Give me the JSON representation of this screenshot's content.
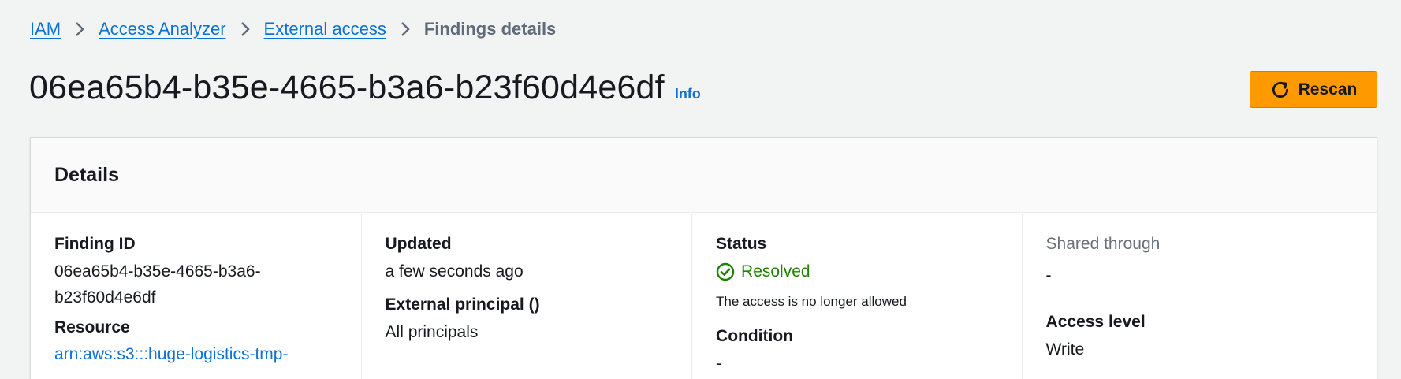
{
  "breadcrumb": {
    "items": [
      "IAM",
      "Access Analyzer",
      "External access"
    ],
    "current": "Findings details"
  },
  "header": {
    "title": "06ea65b4-b35e-4665-b3a6-b23f60d4e6df",
    "info": "Info",
    "rescan_label": "Rescan"
  },
  "details": {
    "title": "Details",
    "finding_id": {
      "label": "Finding ID",
      "value_line1": "06ea65b4-b35e-4665-b3a6-",
      "value_line2": "b23f60d4e6df"
    },
    "resource": {
      "label": "Resource",
      "value": "arn:aws:s3:::huge-logistics-tmp-"
    },
    "updated": {
      "label": "Updated",
      "value": "a few seconds ago"
    },
    "external_principal": {
      "label": "External principal ()",
      "value": "All principals"
    },
    "status": {
      "label": "Status",
      "value": "Resolved",
      "note": "The access is no longer allowed"
    },
    "condition": {
      "label": "Condition",
      "value": "-"
    },
    "shared_through": {
      "label": "Shared through",
      "value": "-"
    },
    "access_level": {
      "label": "Access level",
      "value": "Write"
    }
  },
  "colors": {
    "accent": "#0972d3",
    "primary_button": "#ff9900",
    "status_success": "#1d8102",
    "page_bg": "#f2f3f3"
  },
  "icons": [
    "chevron-right-icon",
    "refresh-icon",
    "check-circle-icon"
  ]
}
